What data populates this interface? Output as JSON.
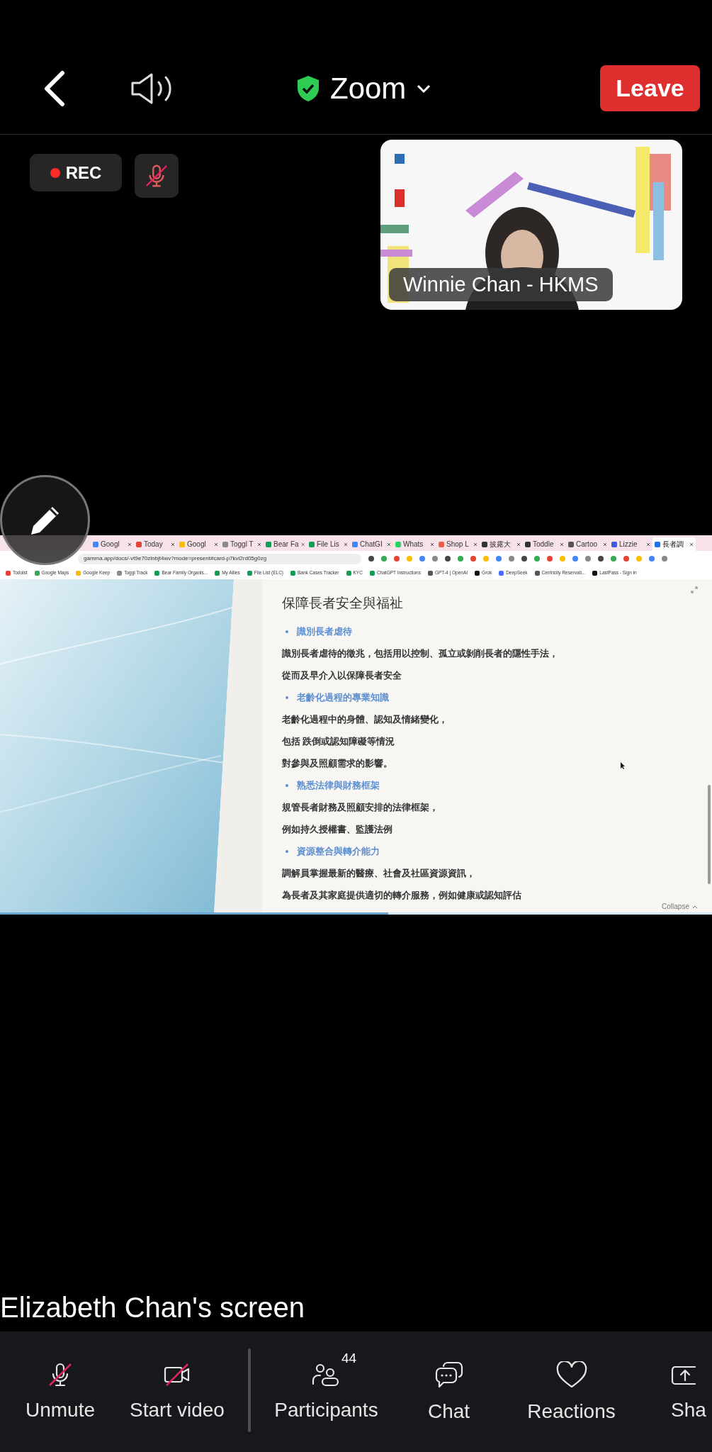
{
  "top_bar": {
    "title": "Zoom",
    "leave": "Leave"
  },
  "status_badges": [
    {
      "kind": "rec",
      "label": "REC"
    },
    {
      "kind": "mic",
      "muted": true
    }
  ],
  "video_tile": {
    "kind": "picture",
    "name": "Winnie Chan - HKMS"
  },
  "shared_screen": {
    "browser": {
      "tabs": [
        {
          "label": "Googl",
          "selected": false,
          "color": "#4285f4"
        },
        {
          "label": "Today",
          "selected": false,
          "color": "#e44232"
        },
        {
          "label": "Googl",
          "selected": false,
          "color": "#fbbc04"
        },
        {
          "label": "Toggl T",
          "selected": false,
          "color": "#8a8a8a"
        },
        {
          "label": "Bear Fa",
          "selected": false,
          "color": "#0f9d58"
        },
        {
          "label": "File Lis",
          "selected": false,
          "color": "#0f9d58"
        },
        {
          "label": "ChatGI",
          "selected": false,
          "color": "#4285f4"
        },
        {
          "label": "Whats",
          "selected": false,
          "color": "#25d366"
        },
        {
          "label": "Shop L",
          "selected": false,
          "color": "#e8604c"
        },
        {
          "label": "披露大",
          "selected": false,
          "color": "#333333"
        },
        {
          "label": "Toddle",
          "selected": false,
          "color": "#333333"
        },
        {
          "label": "Cartoo",
          "selected": false,
          "color": "#555555"
        },
        {
          "label": "Lizzie",
          "selected": false,
          "color": "#3b5bdb"
        },
        {
          "label": "長者調",
          "selected": true,
          "color": "#1a73e8"
        }
      ],
      "url": "gamma.app/docs/-vt9e70zlnbjt4wv?mode=present#card-p7kvi2rd05g0zg",
      "bookmarks": [
        {
          "label": "Todoist",
          "color": "#e44232"
        },
        {
          "label": "Google Maps",
          "color": "#34a853"
        },
        {
          "label": "Google Keep",
          "color": "#fbbc04"
        },
        {
          "label": "Toggl Track",
          "color": "#8a8a8a"
        },
        {
          "label": "Bear Family Organis...",
          "color": "#0f9d58"
        },
        {
          "label": "My Allies",
          "color": "#0f9d58"
        },
        {
          "label": "File List (ELC)",
          "color": "#0f9d58"
        },
        {
          "label": "Bank Cases Tracker",
          "color": "#0f9d58"
        },
        {
          "label": "KYC",
          "color": "#0f9d58"
        },
        {
          "label": "ChatGPT Instructions",
          "color": "#0f9d58"
        },
        {
          "label": "GPT-4 | OpenAI",
          "color": "#555555"
        },
        {
          "label": "Grok",
          "color": "#111111"
        },
        {
          "label": "DeepSeek",
          "color": "#4d6bfe"
        },
        {
          "label": "Centricity Reservati...",
          "color": "#555555"
        },
        {
          "label": "LastPass - Sign in",
          "color": "#111111"
        }
      ]
    },
    "slide": {
      "title": "保障長者安全與福祉",
      "lines": [
        {
          "kind": "heading",
          "text": "識別長者虐待"
        },
        {
          "kind": "body",
          "text": "識別長者虐待的徵兆，包括用以控制、孤立或剝削長者的隱性手法，"
        },
        {
          "kind": "body",
          "text": "從而及早介入以保障長者安全"
        },
        {
          "kind": "heading",
          "text": "老齡化過程的專業知識"
        },
        {
          "kind": "body",
          "text": "老齡化過程中的身體、認知及情緒變化，"
        },
        {
          "kind": "body",
          "text": "包括 跌倒或認知障礙等情況"
        },
        {
          "kind": "body",
          "text": "對參與及照顧需求的影響。"
        },
        {
          "kind": "heading",
          "text": "熟悉法律與財務框架"
        },
        {
          "kind": "body",
          "text": "規管長者財務及照顧安排的法律框架，"
        },
        {
          "kind": "body",
          "text": "例如持久授權書、監護法例"
        },
        {
          "kind": "heading",
          "text": "資源整合與轉介能力"
        },
        {
          "kind": "body",
          "text": "調解員掌握最新的醫療、社會及社區資源資訊，"
        },
        {
          "kind": "body",
          "text": "為長者及其家庭提供適切的轉介服務，例如健康或認知評估"
        }
      ],
      "collapse": "Collapse"
    }
  },
  "sharer_label": "Elizabeth Chan's screen",
  "toolbar": [
    {
      "kind": "mic",
      "label": "Unmute",
      "off": true
    },
    {
      "kind": "video",
      "label": "Start video",
      "off": true
    },
    {
      "kind": "divider"
    },
    {
      "kind": "participants",
      "label": "Participants",
      "count": "44"
    },
    {
      "kind": "chat",
      "label": "Chat"
    },
    {
      "kind": "reactions",
      "label": "Reactions"
    },
    {
      "kind": "share",
      "label": "Sha"
    }
  ]
}
